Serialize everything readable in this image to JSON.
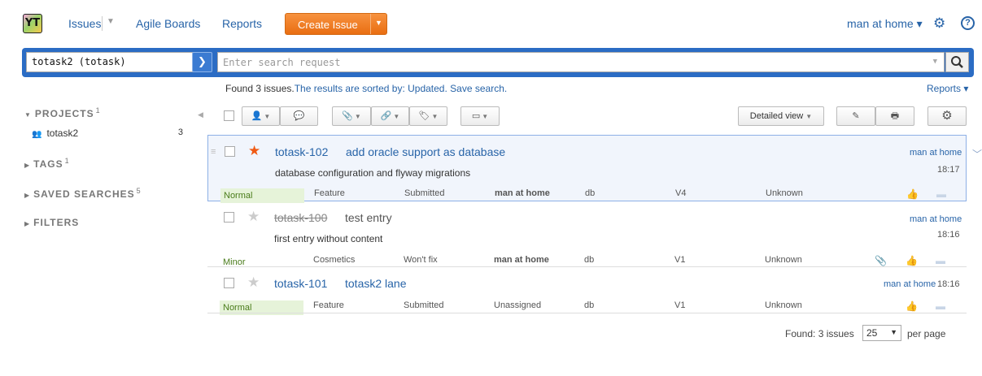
{
  "nav": {
    "logo_text": "YT",
    "issues": "Issues",
    "agile_boards": "Agile Boards",
    "reports": "Reports",
    "create_issue": "Create Issue",
    "user": "man at home ▾",
    "help": "?"
  },
  "search": {
    "context": "totask2 (totask)",
    "placeholder": "Enter search request"
  },
  "results": {
    "found": "Found 3 issues.",
    "sorted": "The results are sorted by: Updated.",
    "save": "Save search.",
    "reports": "Reports ▾"
  },
  "sidebar": {
    "projects": {
      "label": "PROJECTS",
      "count": "1"
    },
    "project_item": {
      "name": "totask2",
      "count": "3"
    },
    "tags": {
      "label": "TAGS",
      "count": "1"
    },
    "saved_searches": {
      "label": "SAVED SEARCHES",
      "count": "5"
    },
    "filters": {
      "label": "FILTERS"
    }
  },
  "toolbar": {
    "detailed_view": "Detailed view"
  },
  "issues": [
    {
      "id": "totask-102",
      "summary": "add oracle support as database",
      "description": "database configuration and flyway migrations",
      "author": "man at home",
      "time": "18:17",
      "starred": true,
      "resolved": false,
      "priority": "Normal",
      "type": "Feature",
      "state": "Submitted",
      "assignee": "man at home",
      "subsystem": "db",
      "fix_version": "V4",
      "affected": "Unknown"
    },
    {
      "id": "totask-100",
      "summary": "test entry",
      "description": "first entry without content",
      "author": "man at home",
      "time": "18:16",
      "starred": false,
      "resolved": true,
      "priority": "Minor",
      "type": "Cosmetics",
      "state": "Won't fix",
      "assignee": "man at home",
      "subsystem": "db",
      "fix_version": "V1",
      "affected": "Unknown"
    },
    {
      "id": "totask-101",
      "summary": "totask2 lane",
      "description": "",
      "author": "man at home",
      "time": "18:16",
      "starred": false,
      "resolved": false,
      "priority": "Normal",
      "type": "Feature",
      "state": "Submitted",
      "assignee": "Unassigned",
      "subsystem": "db",
      "fix_version": "V1",
      "affected": "Unknown"
    }
  ],
  "footer": {
    "found": "Found: 3 issues",
    "per_page_value": "25",
    "per_page_label": "per page"
  },
  "colors": {
    "accent": "#2b6cc4",
    "create": "#f07e1d",
    "star_on": "#f05a14"
  }
}
